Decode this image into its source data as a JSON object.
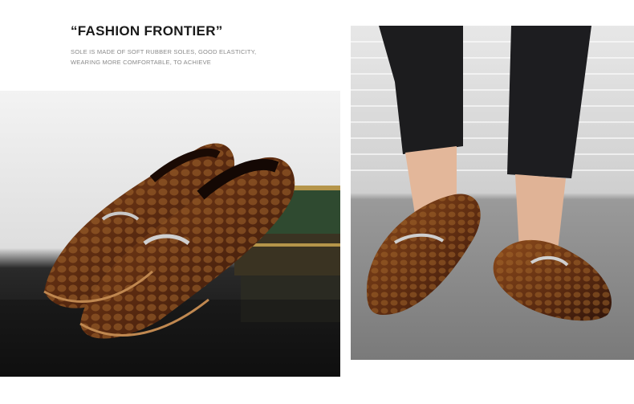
{
  "header": {
    "title": "“FASHION FRONTIER”",
    "description_lines": [
      "SOLE IS MADE OF SOFT RUBBER SOLES, GOOD ELASTICITY,",
      "WEARING MORE COMFORTABLE, TO ACHIEVE"
    ]
  },
  "colors": {
    "leather_dark": "#3a1a0c",
    "leather_mid": "#7a3c16",
    "leather_light": "#b0763a",
    "book_green": "#2f4a30",
    "book_gold": "#b5954a",
    "floor_gray": "#8c8c8c",
    "jeans": "#1c1c1e"
  },
  "images": {
    "left": {
      "icon": "loafers-on-books-image"
    },
    "right": {
      "icon": "loafers-worn-image"
    }
  }
}
